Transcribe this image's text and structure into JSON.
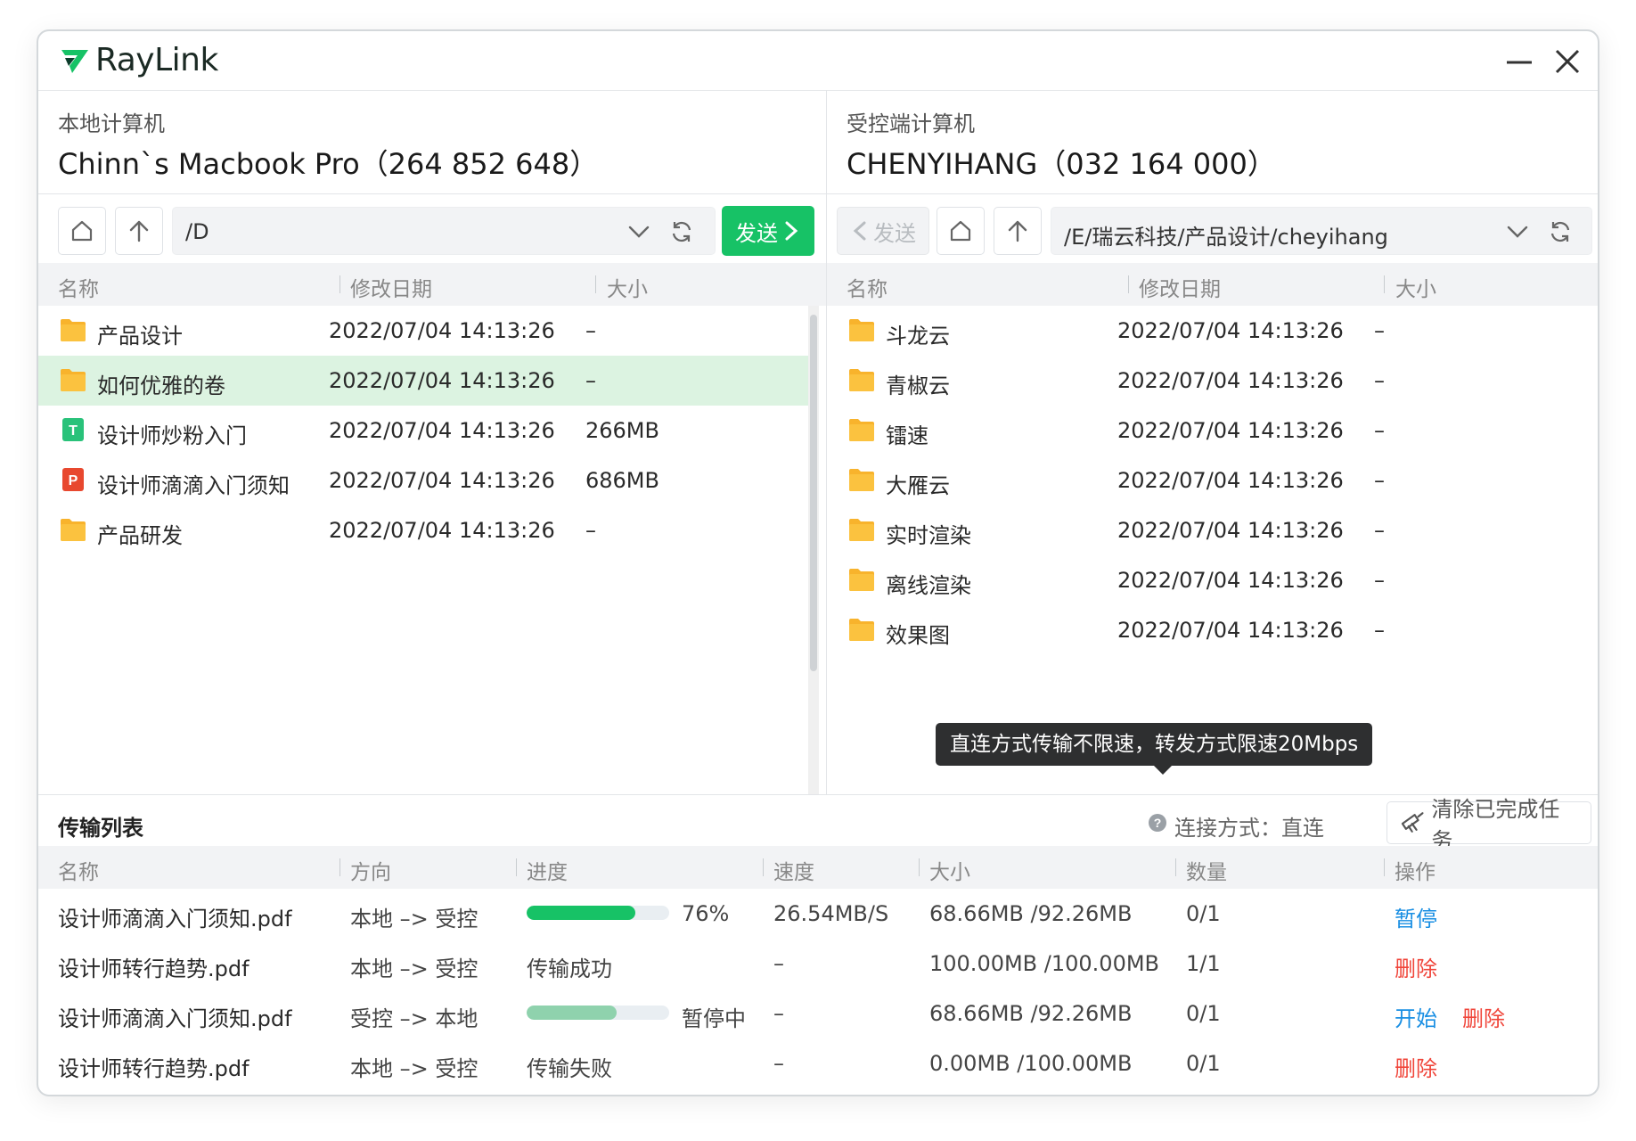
{
  "app": {
    "logo_text": "RayLink"
  },
  "local": {
    "label": "本地计算机",
    "name": "Chinn`s Macbook Pro（264 852 648）",
    "path": "/D",
    "send_label": "发送",
    "columns": [
      "名称",
      "修改日期",
      "大小"
    ],
    "files": [
      {
        "type": "folder",
        "name": "产品设计",
        "date": "2022/07/04 14:13:26",
        "size": "–",
        "selected": false
      },
      {
        "type": "folder",
        "name": "如何优雅的卷",
        "date": "2022/07/04 14:13:26",
        "size": "–",
        "selected": true
      },
      {
        "type": "txt",
        "name": "设计师炒粉入门",
        "date": "2022/07/04 14:13:26",
        "size": "266MB",
        "selected": false,
        "badge": "T"
      },
      {
        "type": "ppt",
        "name": "设计师滴滴入门须知",
        "date": "2022/07/04 14:13:26",
        "size": "686MB",
        "selected": false,
        "badge": "P"
      },
      {
        "type": "folder",
        "name": "产品研发",
        "date": "2022/07/04 14:13:26",
        "size": "–",
        "selected": false
      }
    ]
  },
  "remote": {
    "label": "受控端计算机",
    "name": "CHENYIHANG（032 164 000）",
    "path": "/E/瑞云科技/产品设计/cheyihang",
    "send_label": "发送",
    "columns": [
      "名称",
      "修改日期",
      "大小"
    ],
    "files": [
      {
        "type": "folder",
        "name": "斗龙云",
        "date": "2022/07/04 14:13:26",
        "size": "–"
      },
      {
        "type": "folder",
        "name": "青椒云",
        "date": "2022/07/04 14:13:26",
        "size": "–"
      },
      {
        "type": "folder",
        "name": "镭速",
        "date": "2022/07/04 14:13:26",
        "size": "–"
      },
      {
        "type": "folder",
        "name": "大雁云",
        "date": "2022/07/04 14:13:26",
        "size": "–"
      },
      {
        "type": "folder",
        "name": "实时渲染",
        "date": "2022/07/04 14:13:26",
        "size": "–"
      },
      {
        "type": "folder",
        "name": "离线渲染",
        "date": "2022/07/04 14:13:26",
        "size": "–"
      },
      {
        "type": "folder",
        "name": "效果图",
        "date": "2022/07/04 14:13:26",
        "size": "–"
      }
    ]
  },
  "tooltip": "直连方式传输不限速，转发方式限速20Mbps",
  "transfer": {
    "title": "传输列表",
    "connection": "连接方式：直连",
    "clear_label": "清除已完成任务",
    "columns": [
      "名称",
      "方向",
      "进度",
      "速度",
      "大小",
      "数量",
      "操作"
    ],
    "rows": [
      {
        "name": "设计师滴滴入门须知.pdf",
        "direction": "本地 –> 受控",
        "progress_value": 0.76,
        "progress_text": "76%",
        "progress_color": "#17c266",
        "speed": "26.54MB/S",
        "size": "68.66MB /92.26MB",
        "count": "0/1",
        "actions": [
          {
            "label": "暂停",
            "color": "#1a8fe3"
          }
        ]
      },
      {
        "name": "设计师转行趋势.pdf",
        "direction": "本地 –> 受控",
        "status": "传输成功",
        "speed": "–",
        "size": "100.00MB /100.00MB",
        "count": "1/1",
        "actions": [
          {
            "label": "删除",
            "color": "#f0453a"
          }
        ]
      },
      {
        "name": "设计师滴滴入门须知.pdf",
        "direction": "受控 –> 本地",
        "progress_value": 0.63,
        "progress_text": "暂停中",
        "progress_color": "#8fd2ad",
        "speed": "–",
        "size": "68.66MB /92.26MB",
        "count": "0/1",
        "actions": [
          {
            "label": "开始",
            "color": "#1a8fe3"
          },
          {
            "label": "删除",
            "color": "#f0453a"
          }
        ]
      },
      {
        "name": "设计师转行趋势.pdf",
        "direction": "本地 –> 受控",
        "status": "传输失败",
        "speed": "–",
        "size": "0.00MB /100.00MB",
        "count": "0/1",
        "actions": [
          {
            "label": "删除",
            "color": "#f0453a"
          }
        ]
      }
    ]
  },
  "colors": {
    "brand_green": "#17c266",
    "folder_yellow": "#f8b32c",
    "selected_row": "#dcf3e1",
    "link_blue": "#1a8fe3",
    "danger_red": "#f0453a"
  }
}
